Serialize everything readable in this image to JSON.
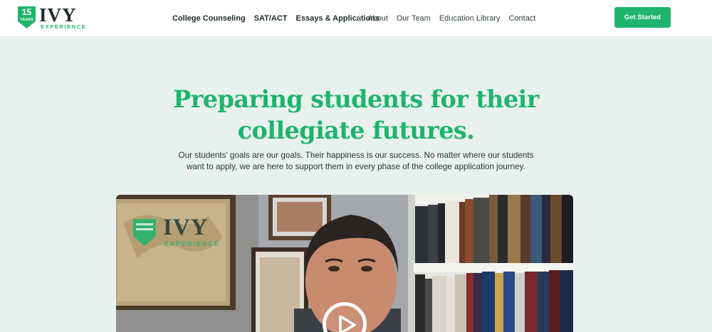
{
  "header": {
    "logo": {
      "badge_number": "15",
      "badge_text": "YEARS",
      "wordmark": "IVY",
      "subtext": "EXPERIENCE"
    },
    "nav_main": [
      {
        "label": "College Counseling"
      },
      {
        "label": "SAT/ACT"
      },
      {
        "label": "Essays & Applications"
      }
    ],
    "nav_secondary": [
      {
        "label": "About"
      },
      {
        "label": "Our Team"
      },
      {
        "label": "Education Library"
      },
      {
        "label": "Contact"
      }
    ],
    "cta_label": "Get Started"
  },
  "hero": {
    "title_line1": "Preparing students for their",
    "title_line2": "collegiate futures.",
    "subtitle_line1": "Our students' goals are our goals. Their happiness is our success. No matter where our students",
    "subtitle_line2": "want to apply, we are here to support them in every phase of the college application journey."
  },
  "video": {
    "logo_wordmark": "IVY",
    "logo_subtext": "EXPERIENCE",
    "play_icon": "play-icon"
  },
  "colors": {
    "brand_green": "#1fb46c",
    "page_background": "#e8f1ee",
    "header_background": "#ffffff",
    "text_dark": "#1f2a2a"
  }
}
